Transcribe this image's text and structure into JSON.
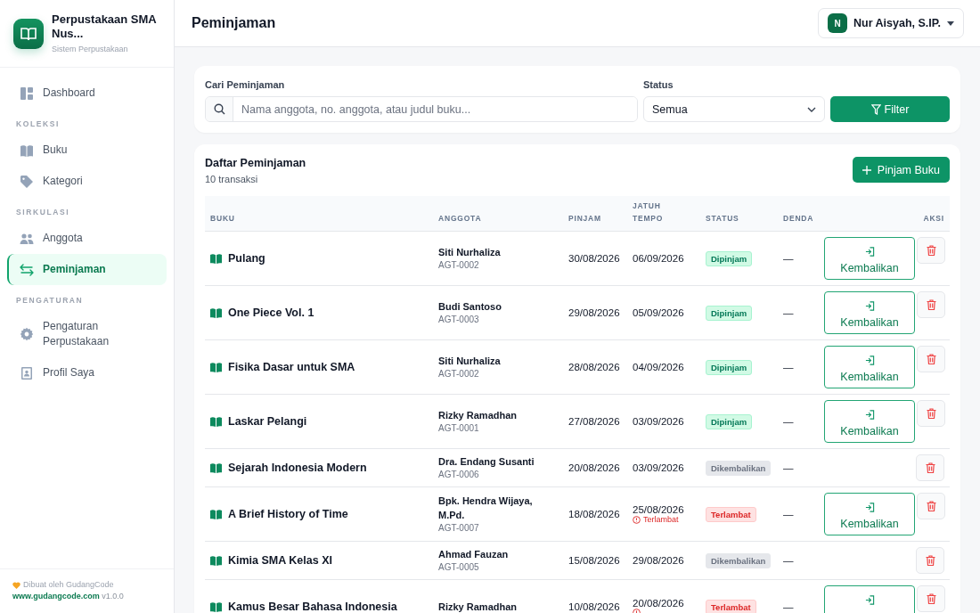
{
  "app": {
    "name": "Perpustakaan SMA Nus...",
    "subtitle": "Sistem Perpustakaan"
  },
  "sidebar": {
    "groups": [
      {
        "items": [
          {
            "label": "Dashboard",
            "selected": false
          }
        ]
      },
      {
        "heading": "KOLEKSI",
        "items": [
          {
            "label": "Buku",
            "selected": false
          },
          {
            "label": "Kategori",
            "selected": false
          }
        ]
      },
      {
        "heading": "SIRKULASI",
        "items": [
          {
            "label": "Anggota",
            "selected": false
          },
          {
            "label": "Peminjaman",
            "selected": true
          }
        ]
      },
      {
        "heading": "PENGATURAN",
        "items": [
          {
            "label": "Pengaturan Perpustakaan",
            "selected": false
          },
          {
            "label": "Profil Saya",
            "selected": false
          }
        ]
      }
    ],
    "footer": {
      "credit": "Dibuat oleh GudangCode",
      "link": "www.gudangcode.com",
      "version": "v1.0.0"
    }
  },
  "header": {
    "title": "Peminjaman",
    "user": {
      "initial": "N",
      "name": "Nur Aisyah, S.IP."
    }
  },
  "filter": {
    "search": {
      "label": "Cari Peminjaman",
      "placeholder": "Nama anggota, no. anggota, atau judul buku..."
    },
    "status": {
      "label": "Status",
      "value": "Semua"
    },
    "button": "Filter"
  },
  "list": {
    "title": "Daftar Peminjaman",
    "count": "10 transaksi",
    "add_button": "Pinjam Buku",
    "columns": [
      "BUKU",
      "ANGGOTA",
      "PINJAM",
      "JATUH TEMPO",
      "STATUS",
      "DENDA",
      "AKSI"
    ],
    "rows": [
      {
        "book": "Pulang",
        "member": "Siti Nurhaliza",
        "member_id": "AGT-0002",
        "loan_date": "30/08/2026",
        "due_date": "06/09/2026",
        "status": {
          "label": "Dipinjam",
          "kind": "borrowed"
        },
        "fine": "—",
        "returnable": true,
        "return_button": "Kembalikan"
      },
      {
        "book": "One Piece Vol. 1",
        "member": "Budi Santoso",
        "member_id": "AGT-0003",
        "loan_date": "29/08/2026",
        "due_date": "05/09/2026",
        "status": {
          "label": "Dipinjam",
          "kind": "borrowed"
        },
        "fine": "—",
        "returnable": true,
        "return_button": "Kembalikan"
      },
      {
        "book": "Fisika Dasar untuk SMA",
        "member": "Siti Nurhaliza",
        "member_id": "AGT-0002",
        "loan_date": "28/08/2026",
        "due_date": "04/09/2026",
        "status": {
          "label": "Dipinjam",
          "kind": "borrowed"
        },
        "fine": "—",
        "returnable": true,
        "return_button": "Kembalikan"
      },
      {
        "book": "Laskar Pelangi",
        "member": "Rizky Ramadhan",
        "member_id": "AGT-0001",
        "loan_date": "27/08/2026",
        "due_date": "03/09/2026",
        "status": {
          "label": "Dipinjam",
          "kind": "borrowed"
        },
        "fine": "—",
        "returnable": true,
        "return_button": "Kembalikan"
      },
      {
        "book": "Sejarah Indonesia Modern",
        "member": "Dra. Endang Susanti",
        "member_id": "AGT-0006",
        "loan_date": "20/08/2026",
        "due_date": "03/09/2026",
        "status": {
          "label": "Dikembalikan",
          "kind": "returned"
        },
        "fine": "—",
        "returnable": false
      },
      {
        "book": "A Brief History of Time",
        "member": "Bpk. Hendra Wijaya, M.Pd.",
        "member_id": "AGT-0007",
        "loan_date": "18/08/2026",
        "due_date": "25/08/2026",
        "overdue": true,
        "due_note": "Terlambat",
        "status": {
          "label": "Terlambat",
          "kind": "late"
        },
        "fine": "—",
        "returnable": true,
        "return_button": "Kembalikan"
      },
      {
        "book": "Kimia SMA Kelas XI",
        "member": "Ahmad Fauzan",
        "member_id": "AGT-0005",
        "loan_date": "15/08/2026",
        "due_date": "29/08/2026",
        "status": {
          "label": "Dikembalikan",
          "kind": "returned"
        },
        "fine": "—",
        "returnable": false
      },
      {
        "book": "Kamus Besar Bahasa Indonesia",
        "member": "Rizky Ramadhan",
        "loan_date": "10/08/2026",
        "due_date": "20/08/2026",
        "overdue": true,
        "status": {
          "label": "Terlambat",
          "kind": "late"
        },
        "fine": "—",
        "returnable": true
      }
    ]
  }
}
